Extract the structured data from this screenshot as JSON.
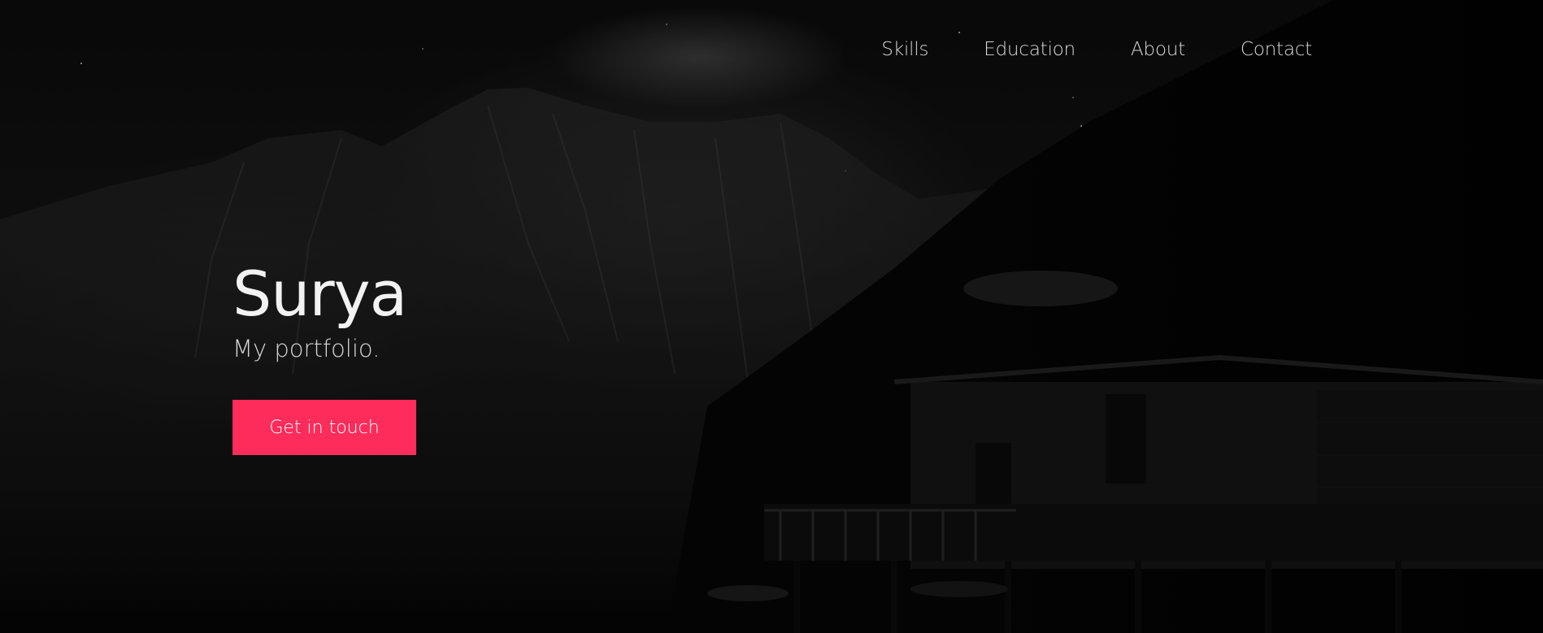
{
  "nav": {
    "items": [
      {
        "label": "Skills"
      },
      {
        "label": "Education"
      },
      {
        "label": "About"
      },
      {
        "label": "Contact"
      }
    ]
  },
  "hero": {
    "title": "Surya",
    "subtitle": "My portfolio.",
    "cta_label": "Get in touch",
    "background": "dark mountain lake with wooden boathouse",
    "accent_color": "#fd2c5b"
  }
}
